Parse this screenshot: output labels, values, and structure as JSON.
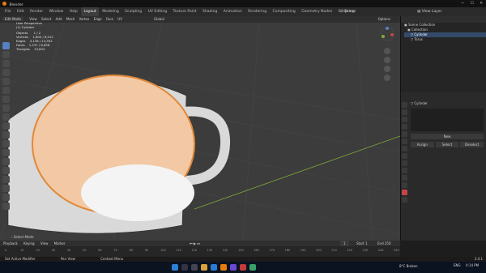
{
  "app": {
    "title": "Blender"
  },
  "menubar": {
    "items": [
      "File",
      "Edit",
      "Render",
      "Window",
      "Help"
    ],
    "workspace_tabs": [
      "Layout",
      "Modeling",
      "Sculpting",
      "UV Editing",
      "Texture Paint",
      "Shading",
      "Animation",
      "Rendering",
      "Compositing",
      "Geometry Nodes",
      "Scripting"
    ],
    "active_tab": "Layout",
    "scene_label": "Scene",
    "view_layer_label": "View Layer"
  },
  "viewport": {
    "mode": "Edit Mode",
    "menus": [
      "View",
      "Select",
      "Add",
      "Mesh",
      "Vertex",
      "Edge",
      "Face",
      "UV"
    ],
    "orientation": "Global",
    "stats": [
      {
        "label": "User Perspective",
        "value": ""
      },
      {
        "label": "(1) Cylinder",
        "value": ""
      },
      {
        "label": "Objects",
        "value": "1 / 2"
      },
      {
        "label": "Vertices",
        "value": "1,600 / 6,912"
      },
      {
        "label": "Edges",
        "value": "3,136 / 13,592"
      },
      {
        "label": "Faces",
        "value": "1,537 / 6,656"
      },
      {
        "label": "Triangles",
        "value": "13,824"
      }
    ],
    "options_label": "Options",
    "select_mode_label": "Select Mode"
  },
  "outliner": {
    "root": "Scene Collection",
    "items": [
      {
        "label": "Collection",
        "selected": false
      },
      {
        "label": "Cylinder",
        "selected": true
      },
      {
        "label": "Torus",
        "selected": false
      }
    ]
  },
  "properties": {
    "object_name": "Cylinder",
    "new_label": "New",
    "buttons": [
      "Assign",
      "Select",
      "Deselect"
    ]
  },
  "timeline": {
    "playback_label": "Playback",
    "keying_label": "Keying",
    "view_label": "View",
    "marker_label": "Marker",
    "current_frame": "1",
    "start_label": "Start",
    "start_value": "1",
    "end_label": "End",
    "end_value": "250",
    "ticks": [
      "0",
      "10",
      "20",
      "30",
      "40",
      "50",
      "60",
      "70",
      "80",
      "90",
      "100",
      "110",
      "120",
      "130",
      "140",
      "150",
      "160",
      "170",
      "180",
      "190",
      "200",
      "210",
      "220",
      "230",
      "240",
      "250"
    ]
  },
  "statusbar": {
    "left": "Set Active Modifier",
    "middle": "Pan View",
    "right": "Context Menu",
    "version": "3.4.1"
  },
  "taskbar": {
    "search_placeholder": "Search",
    "weather": "8°C Broken",
    "time": "4:14 PM",
    "lang": "ENG"
  },
  "colors": {
    "accent": "#5680c2",
    "mesh_orange": "#e0893a",
    "viewport_bg": "#3c3c3c"
  }
}
